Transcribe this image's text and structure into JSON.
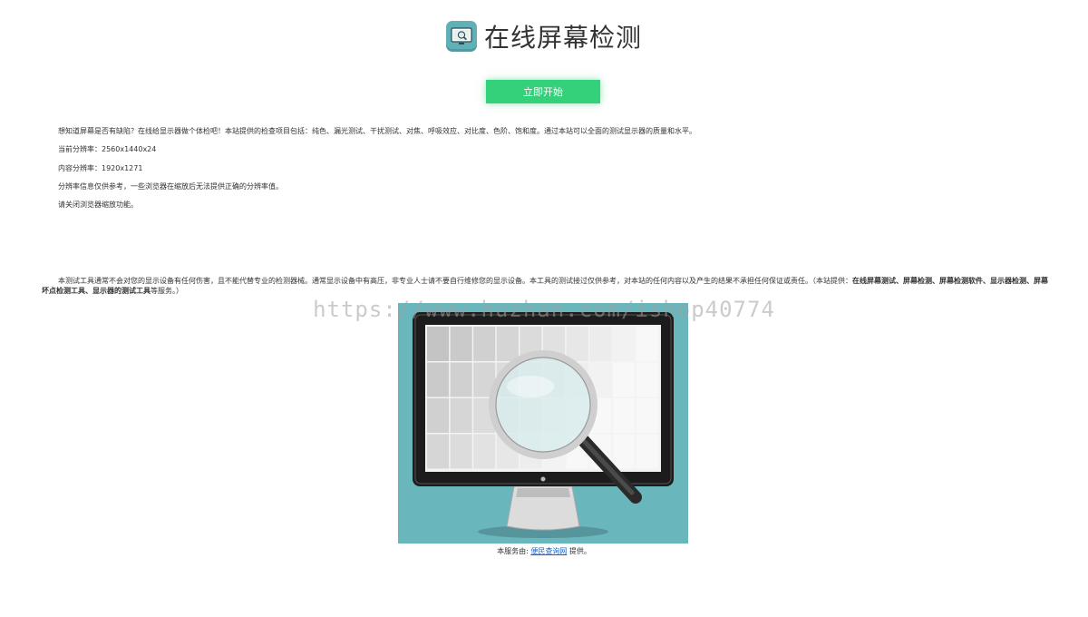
{
  "header": {
    "title": "在线屏幕检测",
    "logo_icon": "monitor-magnifier-icon"
  },
  "start_button": {
    "label": "立即开始",
    "color": "#34d07a"
  },
  "info": {
    "intro": "想知道屏幕是否有缺陷？在线给显示器做个体检吧！本站提供的检查项目包括：纯色、漏光测试、干扰测试、对焦、呼吸效应、对比度、色阶、饱和度。通过本站可以全面的测试显示器的质量和水平。",
    "current_resolution": "当前分辨率：2560x1440x24",
    "content_resolution": "内容分辨率：1920x1271",
    "note": "分辨率信息仅供参考，一些浏览器在缩放后无法提供正确的分辨率值。",
    "zoom_note": "请关闭浏览器缩放功能。"
  },
  "disclaimer": {
    "text": "本测试工具通常不会对您的显示设备有任何伤害，且不能代替专业的检测器械。通常显示设备中有高压，非专业人士请不要自行维修您的显示设备。本工具的测试接过仅供参考，对本站的任何内容以及产生的结果不承担任何保证或责任。（本站提供：",
    "bold": "在线屏幕测试、屏幕检测、屏幕检测软件、显示器检测、屏幕坏点检测工具、显示器的测试工具",
    "suffix": "等服务。）"
  },
  "watermark": "https://www.huzhan.com/ishop40774",
  "illustration": {
    "background": "#69b6bd"
  },
  "footer": {
    "prefix": "本服务由:",
    "link": "便民查询网",
    "suffix": " 提供。"
  }
}
